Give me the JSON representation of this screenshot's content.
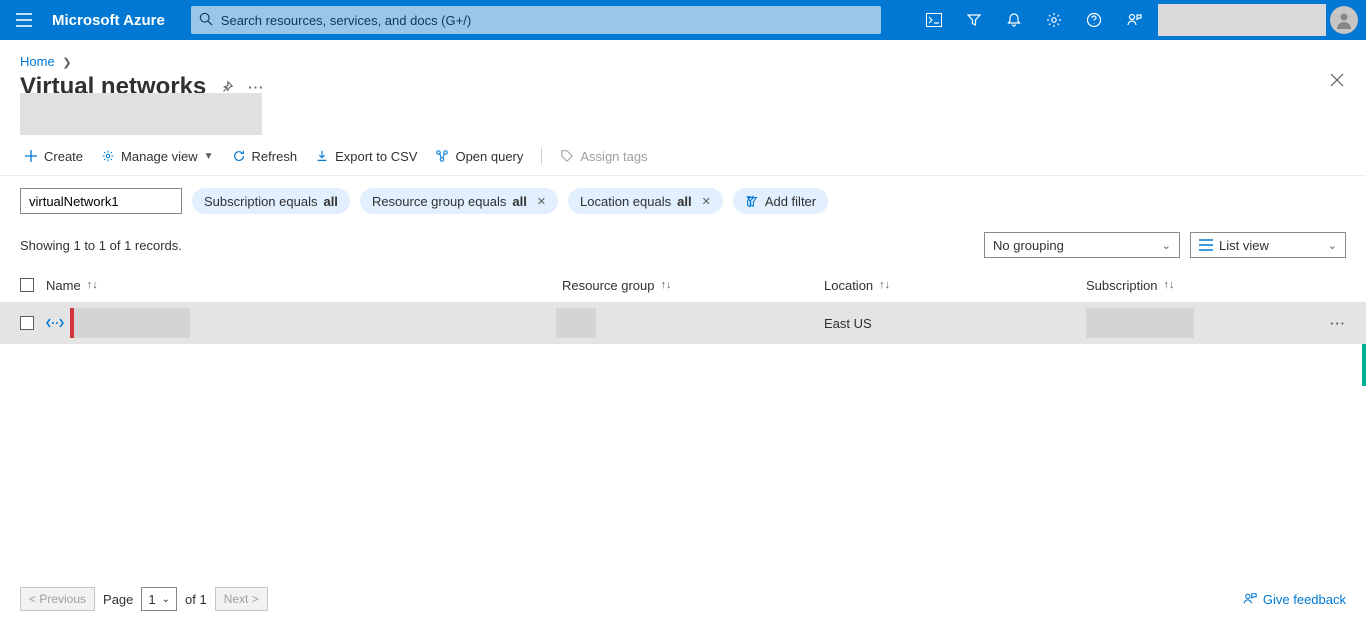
{
  "header": {
    "brand": "Microsoft Azure",
    "search_placeholder": "Search resources, services, and docs (G+/)"
  },
  "breadcrumb": {
    "home": "Home"
  },
  "page": {
    "title": "Virtual networks"
  },
  "toolbar": {
    "create": "Create",
    "manage_view": "Manage view",
    "refresh": "Refresh",
    "export_csv": "Export to CSV",
    "open_query": "Open query",
    "assign_tags": "Assign tags"
  },
  "filters": {
    "input_value": "virtualNetwork1",
    "subscription_prefix": "Subscription equals ",
    "subscription_value": "all",
    "rg_prefix": "Resource group equals ",
    "rg_value": "all",
    "location_prefix": "Location equals ",
    "location_value": "all",
    "add_filter": "Add filter"
  },
  "records": {
    "summary": "Showing 1 to 1 of 1 records.",
    "grouping": "No grouping",
    "view": "List view"
  },
  "columns": {
    "name": "Name",
    "resource_group": "Resource group",
    "location": "Location",
    "subscription": "Subscription"
  },
  "rows": [
    {
      "name": "",
      "resource_group": "",
      "location": "East US",
      "subscription": ""
    }
  ],
  "pager": {
    "previous": "< Previous",
    "page_label": "Page",
    "current": "1",
    "of_label": "of 1",
    "next": "Next >"
  },
  "feedback": {
    "label": "Give feedback"
  }
}
